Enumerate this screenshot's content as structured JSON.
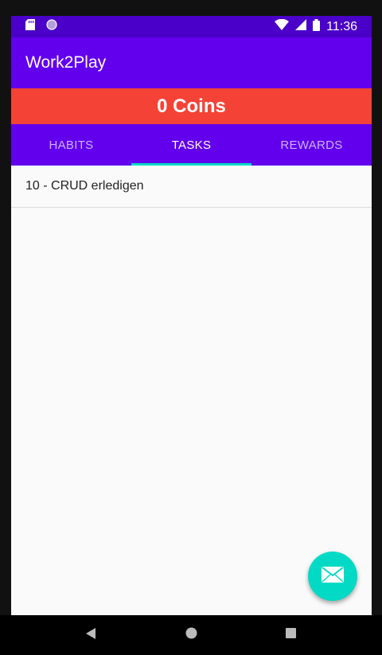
{
  "status_bar": {
    "time": "11:36",
    "icons": [
      "sd-card-icon",
      "circle-notification-icon",
      "wifi-icon",
      "signal-icon",
      "battery-icon"
    ]
  },
  "app_bar": {
    "title": "Work2Play"
  },
  "coins_banner": {
    "text": "0 Coins",
    "color": "#f44336"
  },
  "tabs": [
    {
      "label": "HABITS",
      "active": false
    },
    {
      "label": "TASKS",
      "active": true
    },
    {
      "label": "REWARDS",
      "active": false
    }
  ],
  "tasks": [
    {
      "label": "10 - CRUD erledigen"
    }
  ],
  "fab": {
    "icon": "email-icon",
    "color": "#03dac5"
  },
  "nav_bar": {
    "buttons": [
      "back-icon",
      "home-icon",
      "recents-icon"
    ]
  },
  "colors": {
    "primary": "#6200ee",
    "status": "#4a00c8",
    "accent": "#03dac5"
  }
}
